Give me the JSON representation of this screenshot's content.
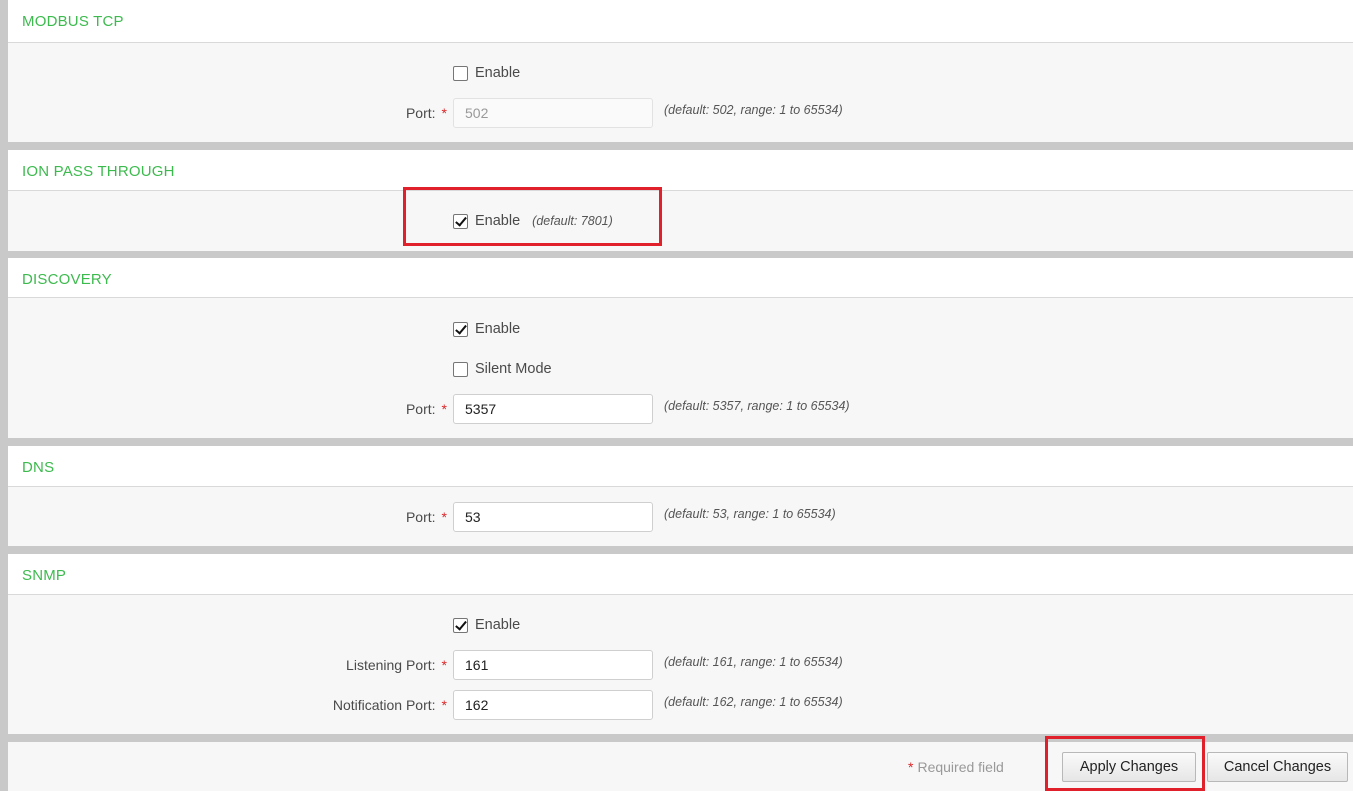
{
  "modbus": {
    "title": "MODBUS TCP",
    "enable_label": "Enable",
    "enable_checked": false,
    "port_label": "Port:",
    "port_value": "502",
    "port_hint": "(default: 502, range: 1 to 65534)"
  },
  "ion": {
    "title": "ION PASS THROUGH",
    "enable_label": "Enable",
    "enable_checked": true,
    "enable_hint": "(default: 7801)"
  },
  "discovery": {
    "title": "DISCOVERY",
    "enable_label": "Enable",
    "enable_checked": true,
    "silent_label": "Silent Mode",
    "silent_checked": false,
    "port_label": "Port:",
    "port_value": "5357",
    "port_hint": "(default: 5357, range: 1 to 65534)"
  },
  "dns": {
    "title": "DNS",
    "port_label": "Port:",
    "port_value": "53",
    "port_hint": "(default: 53, range: 1 to 65534)"
  },
  "snmp": {
    "title": "SNMP",
    "enable_label": "Enable",
    "enable_checked": true,
    "listening_label": "Listening Port:",
    "listening_value": "161",
    "listening_hint": "(default: 161, range: 1 to 65534)",
    "notification_label": "Notification Port:",
    "notification_value": "162",
    "notification_hint": "(default: 162, range: 1 to 65534)"
  },
  "footer": {
    "required_star": "*",
    "required_text": "Required field",
    "apply_label": "Apply Changes",
    "cancel_label": "Cancel Changes"
  },
  "required_marker": "*",
  "colors": {
    "section_title": "#3dba4e",
    "required": "#d9262a",
    "highlight_box": "#e0202a"
  }
}
